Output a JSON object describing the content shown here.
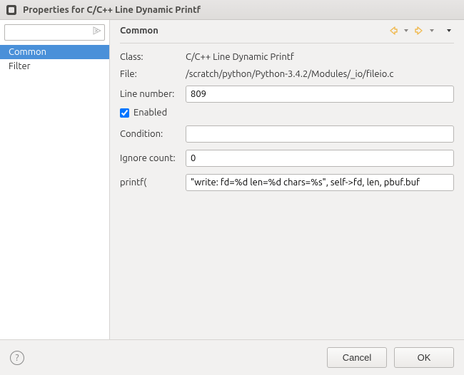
{
  "window": {
    "title": "Properties for C/C++ Line Dynamic Printf"
  },
  "sidebar": {
    "filter_value": "",
    "filter_placeholder": "",
    "items": [
      {
        "label": "Common",
        "selected": true
      },
      {
        "label": "Filter",
        "selected": false
      }
    ]
  },
  "main": {
    "heading": "Common",
    "fields": {
      "class_label": "Class:",
      "class_value": "C/C++ Line Dynamic Printf",
      "file_label": "File:",
      "file_value": "/scratch/python/Python-3.4.2/Modules/_io/fileio.c",
      "line_label": "Line number:",
      "line_value": "809",
      "enabled_label": "Enabled",
      "enabled_checked": true,
      "condition_label": "Condition:",
      "condition_value": "",
      "ignore_label": "Ignore count:",
      "ignore_value": "0",
      "printf_label": "printf(",
      "printf_value": "\"write: fd=%d len=%d chars=%s\", self->fd, len, pbuf.buf"
    }
  },
  "footer": {
    "help": "?",
    "cancel": "Cancel",
    "ok": "OK"
  },
  "colors": {
    "selection": "#4a90d9",
    "nav_back": "#f0b94f",
    "nav_forward": "#f0b94f"
  }
}
